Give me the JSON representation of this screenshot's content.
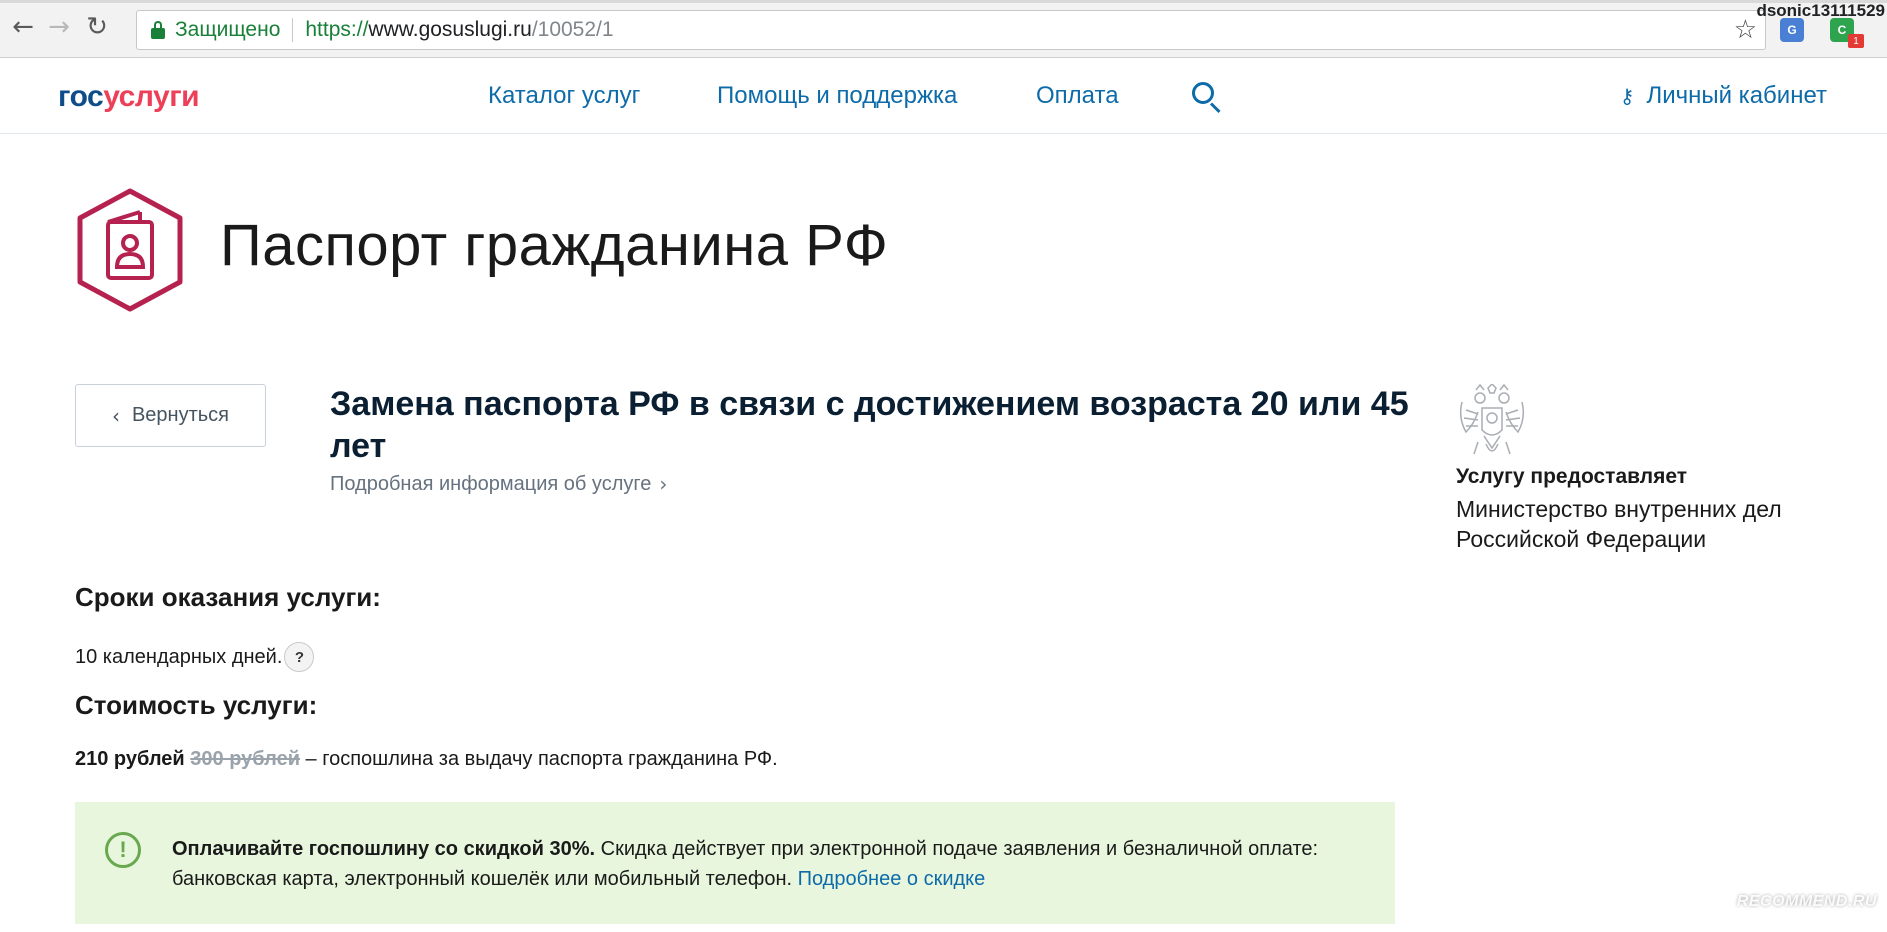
{
  "browser": {
    "secure_label": "Защищено",
    "url_proto": "https://",
    "url_host": "www.gosuslugi.ru",
    "url_path": "/10052/1",
    "user": "dsonic13111529",
    "ext_badge": "1"
  },
  "header": {
    "logo_part1": "гос",
    "logo_part2": "услуги",
    "nav": [
      "Каталог услуг",
      "Помощь и поддержка",
      "Оплата"
    ],
    "cabinet": "Личный кабинет"
  },
  "page": {
    "title": "Паспорт гражданина РФ",
    "back_label": "Вернуться"
  },
  "service": {
    "title": "Замена паспорта РФ в связи с достижением возраста 20 или 45 лет",
    "info_link": "Подробная информация об услуге"
  },
  "provider": {
    "label": "Услугу предоставляет",
    "name": "Министерство внутренних дел Российской Федерации"
  },
  "terms": {
    "heading": "Сроки оказания услуги:",
    "value": "10 календарных дней.",
    "help": "?"
  },
  "cost": {
    "heading": "Стоимость услуги:",
    "price": "210 рублей",
    "old_price": "300 рублей",
    "description": " – госпошлина за выдачу паспорта гражданина РФ."
  },
  "discount": {
    "bold_text": "Оплачивайте госпошлину со скидкой 30%.",
    "text": " Скидка действует при электронной подаче заявления и безналичной оплате: банковская карта, электронный кошелёк или мобильный телефон. ",
    "link": "Подробнее о скидке"
  },
  "watermark": "RECOMMEND.RU",
  "colors": {
    "link": "#0d6ba9",
    "brand_red": "#ee3f58",
    "brand_blue": "#0f4c8a",
    "discount_bg": "#e8f6de",
    "icon_accent": "#b5224f"
  }
}
